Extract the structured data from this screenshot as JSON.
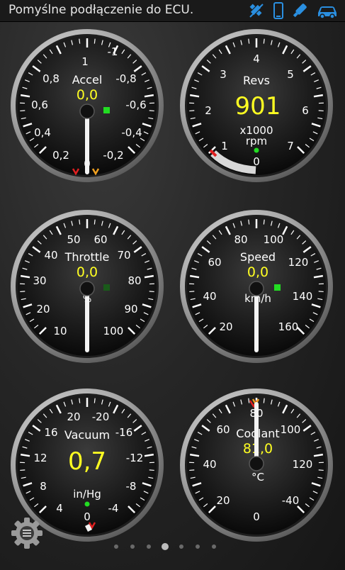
{
  "status_bar": {
    "message": "Pomyślne podłączenie do ECU.",
    "icons": [
      "gps-disabled-icon",
      "phone-icon",
      "bluetooth-adapter-icon",
      "car-icon"
    ],
    "icon_color": "#2a8fe0"
  },
  "gauges": [
    {
      "id": "accel",
      "label": "Accel",
      "value": "0,0",
      "unit": "",
      "ticks": [
        "-1",
        "-0,8",
        "-0,6",
        "-0,4",
        "-0,2",
        "0",
        "0,2",
        "0,4",
        "0,6",
        "0,8",
        "1"
      ],
      "indicator": "green-square"
    },
    {
      "id": "revs",
      "label": "Revs",
      "value": "901",
      "unit": "x1000\nrpm",
      "unit_line1": "x1000",
      "unit_line2": "rpm",
      "ticks": [
        "0",
        "1",
        "2",
        "3",
        "4",
        "5",
        "6",
        "7"
      ],
      "indicator": "green-dot"
    },
    {
      "id": "throttle",
      "label": "Throttle",
      "value": "0,0",
      "unit": "%",
      "ticks": [
        "10",
        "20",
        "30",
        "40",
        "50",
        "60",
        "70",
        "80",
        "90",
        "100"
      ],
      "indicator": "dark-green-square"
    },
    {
      "id": "speed",
      "label": "Speed",
      "value": "0,0",
      "unit": "km/h",
      "ticks": [
        "20",
        "40",
        "60",
        "80",
        "100",
        "120",
        "140",
        "160"
      ],
      "indicator": "green-square"
    },
    {
      "id": "vacuum",
      "label": "Vacuum",
      "value": "0,7",
      "unit": "in/Hg",
      "ticks": [
        "0",
        "-4",
        "-8",
        "-12",
        "-16",
        "-20",
        "20",
        "16",
        "12",
        "8",
        "4"
      ],
      "indicator": "green-dot"
    },
    {
      "id": "coolant",
      "label": "Coolant",
      "value": "81,0",
      "unit": "°C",
      "ticks": [
        "-40",
        "0",
        "20",
        "40",
        "60",
        "80",
        "100",
        "120"
      ],
      "indicator": "none"
    }
  ],
  "page_indicator": {
    "count": 7,
    "active_index": 3
  },
  "menu": {
    "icon": "settings-gear-icon"
  }
}
